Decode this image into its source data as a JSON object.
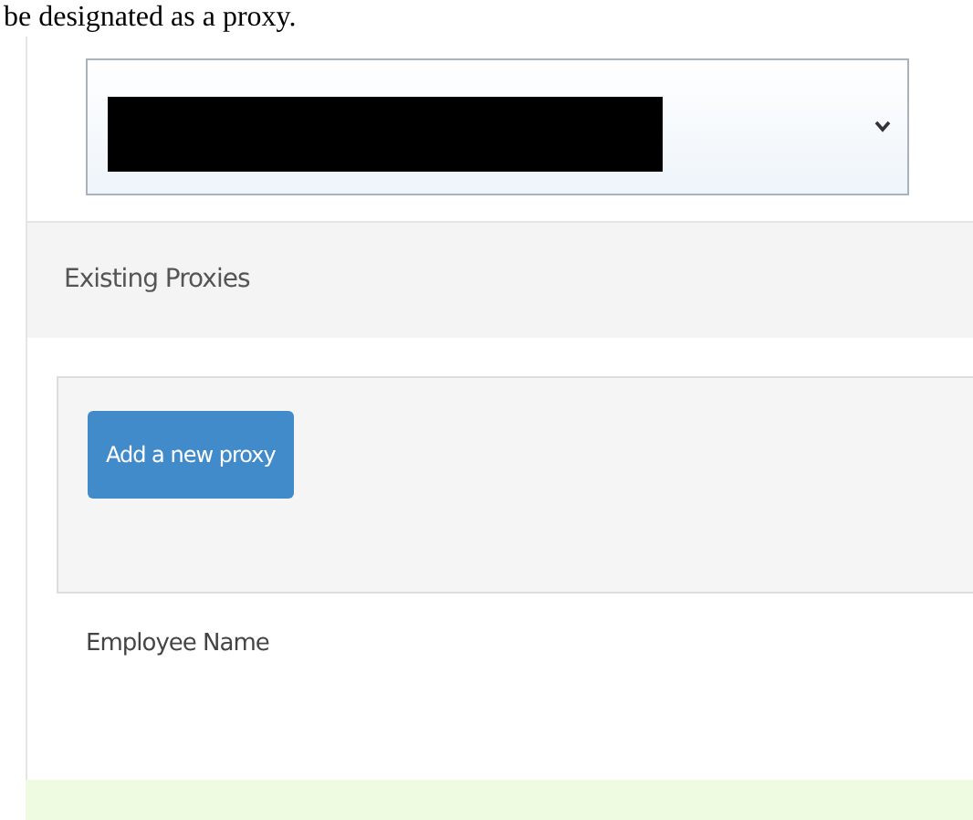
{
  "intro_text": "be designated as a proxy.",
  "proxy_select": {
    "value_redacted": true
  },
  "section": {
    "title": "Existing Proxies"
  },
  "add_button": {
    "label": "Add a new proxy"
  },
  "table": {
    "columns": [
      "Employee Name"
    ]
  }
}
